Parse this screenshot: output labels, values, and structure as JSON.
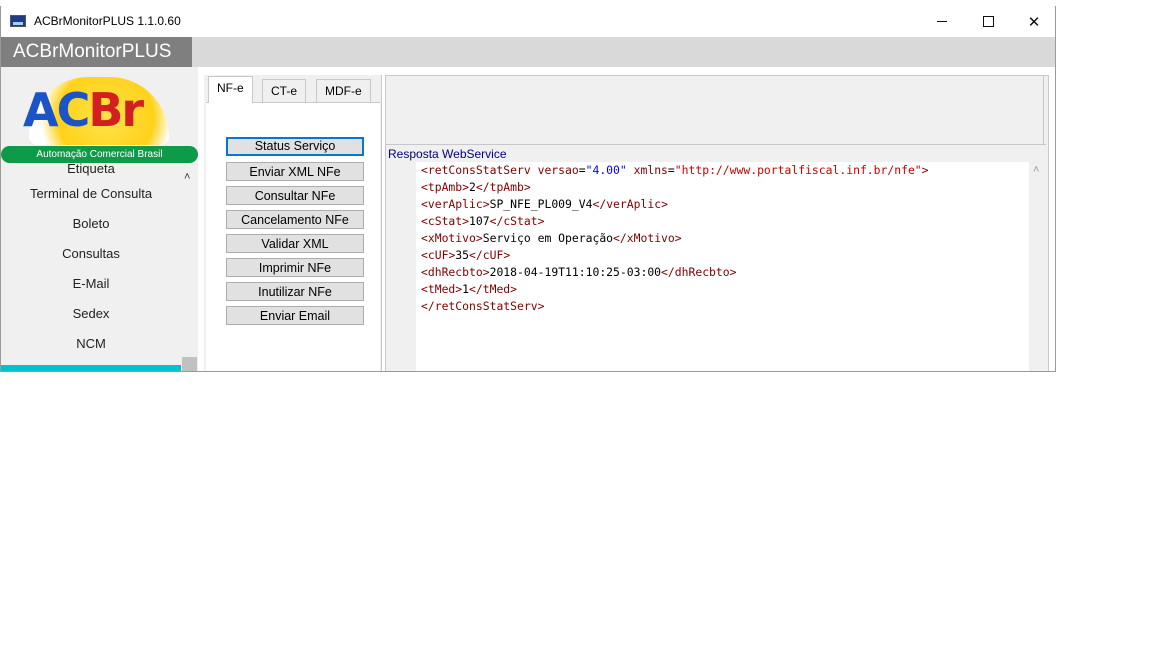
{
  "window": {
    "title": "ACBrMonitorPLUS 1.1.0.60"
  },
  "header": {
    "app_label": "ACBrMonitorPLUS"
  },
  "logo": {
    "text_a": "AC",
    "text_b": "Br",
    "band": "Automação Comercial Brasil"
  },
  "sidebar": {
    "items": [
      {
        "label": "Etiqueta"
      },
      {
        "label": "Terminal de Consulta"
      },
      {
        "label": "Boleto"
      },
      {
        "label": "Consultas"
      },
      {
        "label": "E-Mail"
      },
      {
        "label": "Sedex"
      },
      {
        "label": "NCM"
      }
    ],
    "active_color": "#00c3cf"
  },
  "tabs": [
    {
      "label": "NF-e"
    },
    {
      "label": "CT-e"
    },
    {
      "label": "MDF-e"
    }
  ],
  "actions": [
    {
      "label": "Status Serviço"
    },
    {
      "label": "Enviar XML NFe"
    },
    {
      "label": "Consultar NFe"
    },
    {
      "label": "Cancelamento NFe"
    },
    {
      "label": "Validar XML"
    },
    {
      "label": "Imprimir NFe"
    },
    {
      "label": "Inutilizar NFe"
    },
    {
      "label": "Enviar Email"
    }
  ],
  "response": {
    "label": "Resposta WebService",
    "root_tag": "retConsStatServ",
    "versao_attr": "versao",
    "versao": "\"4.00\"",
    "xmlns_attr": "xmlns",
    "xmlns": "\"http://www.portalfiscal.inf.br/nfe\"",
    "fields": [
      {
        "tag": "tpAmb",
        "value": "2"
      },
      {
        "tag": "verAplic",
        "value": "SP_NFE_PL009_V4"
      },
      {
        "tag": "cStat",
        "value": "107"
      },
      {
        "tag": "xMotivo",
        "value": "Serviço em Operação"
      },
      {
        "tag": "cUF",
        "value": "35"
      },
      {
        "tag": "dhRecbto",
        "value": "2018-04-19T11:10:25-03:00"
      },
      {
        "tag": "tMed",
        "value": "1"
      }
    ]
  },
  "icons": {
    "scroll_up": "chevron-up-icon",
    "close": "close-icon",
    "maximize": "maximize-icon",
    "minimize": "minimize-icon"
  }
}
